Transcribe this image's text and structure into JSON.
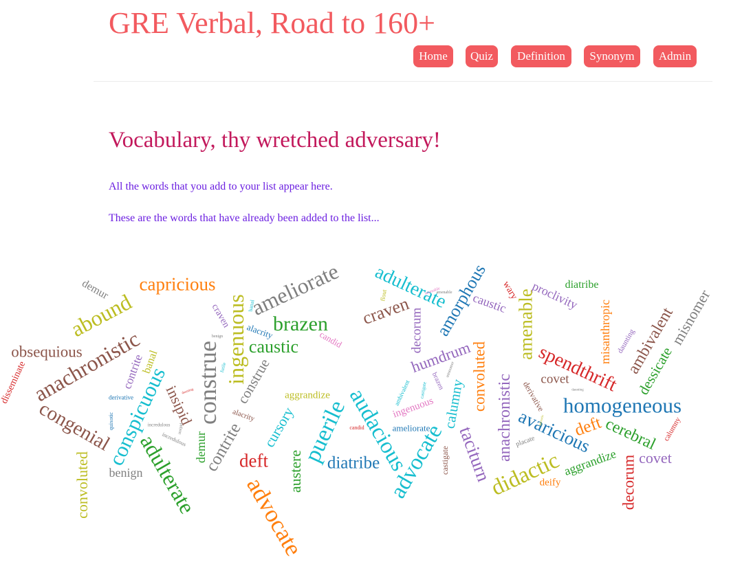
{
  "header": {
    "title": "GRE Verbal, Road to 160+",
    "nav": [
      "Home",
      "Quiz",
      "Definition",
      "Synonym",
      "Admin"
    ],
    "accent_color": "#f25a5f"
  },
  "main": {
    "heading": "Vocabulary, thy wretched adversary!",
    "para1": "All the words that you add to your list appear here.",
    "para2": "These are the words that have already been added to the list..."
  },
  "word_cloud": {
    "words": [
      {
        "text": "demur",
        "color": "#7f7f7f",
        "rotation": 30,
        "weight": 16
      },
      {
        "text": "capricious",
        "color": "#ff7f0e",
        "rotation": 0,
        "weight": 27
      },
      {
        "text": "abound",
        "color": "#bcbd22",
        "rotation": -28,
        "weight": 32
      },
      {
        "text": "obsequious",
        "color": "#8c564b",
        "rotation": 0,
        "weight": 23
      },
      {
        "text": "anachronistic",
        "color": "#8c564b",
        "rotation": -30,
        "weight": 32
      },
      {
        "text": "disseminate",
        "color": "#d62728",
        "rotation": -65,
        "weight": 14
      },
      {
        "text": "congenial",
        "color": "#8c564b",
        "rotation": 30,
        "weight": 29
      },
      {
        "text": "contrite",
        "color": "#9467bd",
        "rotation": -70,
        "weight": 17
      },
      {
        "text": "banal",
        "color": "#bcbd22",
        "rotation": -70,
        "weight": 16
      },
      {
        "text": "conspicuous",
        "color": "#17becf",
        "rotation": -65,
        "weight": 31
      },
      {
        "text": "insipid",
        "color": "#8c564b",
        "rotation": 65,
        "weight": 22
      },
      {
        "text": "adulterate",
        "color": "#2ca02c",
        "rotation": 60,
        "weight": 32
      },
      {
        "text": "convoluted",
        "color": "#bcbd22",
        "rotation": -90,
        "weight": 22
      },
      {
        "text": "benign",
        "color": "#7f7f7f",
        "rotation": 0,
        "weight": 18
      },
      {
        "text": "derivative",
        "color": "#1f77b4",
        "rotation": 0,
        "weight": 9
      },
      {
        "text": "quixotic",
        "color": "#1f77b4",
        "rotation": -90,
        "weight": 8
      },
      {
        "text": "incredulous",
        "color": "#7f7f7f",
        "rotation": 0,
        "weight": 7
      },
      {
        "text": "incredulous",
        "color": "#7f7f7f",
        "rotation": 25,
        "weight": 8
      },
      {
        "text": "craven",
        "color": "#9467bd",
        "rotation": 60,
        "weight": 14
      },
      {
        "text": "banal",
        "color": "#17becf",
        "rotation": -80,
        "weight": 8
      },
      {
        "text": "benign",
        "color": "#7f7f7f",
        "rotation": 0,
        "weight": 6
      },
      {
        "text": "ingenuous",
        "color": "#bcbd22",
        "rotation": -90,
        "weight": 32
      },
      {
        "text": "ameliorate",
        "color": "#7f7f7f",
        "rotation": -25,
        "weight": 32
      },
      {
        "text": "brazen",
        "color": "#2ca02c",
        "rotation": 0,
        "weight": 30
      },
      {
        "text": "alacrity",
        "color": "#1f77b4",
        "rotation": 20,
        "weight": 13
      },
      {
        "text": "caustic",
        "color": "#2ca02c",
        "rotation": 0,
        "weight": 26
      },
      {
        "text": "candid",
        "color": "#e377c2",
        "rotation": 30,
        "weight": 13
      },
      {
        "text": "construe",
        "color": "#7f7f7f",
        "rotation": -90,
        "weight": 36
      },
      {
        "text": "construe",
        "color": "#7f7f7f",
        "rotation": -60,
        "weight": 21
      },
      {
        "text": "futile",
        "color": "#17becf",
        "rotation": -75,
        "weight": 7
      },
      {
        "text": "demur",
        "color": "#2ca02c",
        "rotation": -90,
        "weight": 18
      },
      {
        "text": "contrite",
        "color": "#7f7f7f",
        "rotation": -60,
        "weight": 25
      },
      {
        "text": "alacrity",
        "color": "#8c564b",
        "rotation": 20,
        "weight": 11
      },
      {
        "text": "cursory",
        "color": "#17becf",
        "rotation": -60,
        "weight": 21
      },
      {
        "text": "aggrandize",
        "color": "#bcbd22",
        "rotation": 0,
        "weight": 15
      },
      {
        "text": "deft",
        "color": "#d62728",
        "rotation": 0,
        "weight": 27
      },
      {
        "text": "austere",
        "color": "#2ca02c",
        "rotation": -90,
        "weight": 22
      },
      {
        "text": "advocate",
        "color": "#ff7f0e",
        "rotation": 60,
        "weight": 35
      },
      {
        "text": "puerile",
        "color": "#17becf",
        "rotation": -65,
        "weight": 34
      },
      {
        "text": "diatribe",
        "color": "#1f77b4",
        "rotation": 0,
        "weight": 25
      },
      {
        "text": "audacious",
        "color": "#17becf",
        "rotation": 60,
        "weight": 33
      },
      {
        "text": "adulterate",
        "color": "#17becf",
        "rotation": 25,
        "weight": 28
      },
      {
        "text": "flout",
        "color": "#bcbd22",
        "rotation": -80,
        "weight": 9
      },
      {
        "text": "craven",
        "color": "#8c564b",
        "rotation": -20,
        "weight": 26
      },
      {
        "text": "decorum",
        "color": "#9467bd",
        "rotation": -90,
        "weight": 19
      },
      {
        "text": "amenable",
        "color": "#7f7f7f",
        "rotation": 0,
        "weight": 6
      },
      {
        "text": "amorphous",
        "color": "#1f77b4",
        "rotation": -60,
        "weight": 26
      },
      {
        "text": "caustic",
        "color": "#9467bd",
        "rotation": 20,
        "weight": 18
      },
      {
        "text": "wary",
        "color": "#d62728",
        "rotation": 60,
        "weight": 14
      },
      {
        "text": "proclivity",
        "color": "#9467bd",
        "rotation": 25,
        "weight": 18
      },
      {
        "text": "diatribe",
        "color": "#2ca02c",
        "rotation": 0,
        "weight": 16
      },
      {
        "text": "amenable",
        "color": "#bcbd22",
        "rotation": -90,
        "weight": 27
      },
      {
        "text": "misanthropic",
        "color": "#ff7f0e",
        "rotation": -90,
        "weight": 18
      },
      {
        "text": "ambivalent",
        "color": "#8c564b",
        "rotation": -60,
        "weight": 24
      },
      {
        "text": "misnomer",
        "color": "#7f7f7f",
        "rotation": -60,
        "weight": 22
      },
      {
        "text": "daunting",
        "color": "#9467bd",
        "rotation": -60,
        "weight": 11
      },
      {
        "text": "dessicate",
        "color": "#2ca02c",
        "rotation": -60,
        "weight": 21
      },
      {
        "text": "humdrum",
        "color": "#9467bd",
        "rotation": -20,
        "weight": 23
      },
      {
        "text": "convoluted",
        "color": "#ff7f0e",
        "rotation": -90,
        "weight": 23
      },
      {
        "text": "spendthrift",
        "color": "#d62728",
        "rotation": 25,
        "weight": 28
      },
      {
        "text": "covet",
        "color": "#8c564b",
        "rotation": 0,
        "weight": 19
      },
      {
        "text": "derivative",
        "color": "#8c564b",
        "rotation": 60,
        "weight": 12
      },
      {
        "text": "homogeneous",
        "color": "#1f77b4",
        "rotation": 0,
        "weight": 31
      },
      {
        "text": "avaricious",
        "color": "#1f77b4",
        "rotation": 25,
        "weight": 27
      },
      {
        "text": "deft",
        "color": "#ff7f0e",
        "rotation": -20,
        "weight": 25
      },
      {
        "text": "cerebral",
        "color": "#2ca02c",
        "rotation": 25,
        "weight": 24
      },
      {
        "text": "calumny",
        "color": "#d62728",
        "rotation": -60,
        "weight": 11
      },
      {
        "text": "covet",
        "color": "#9467bd",
        "rotation": 0,
        "weight": 22
      },
      {
        "text": "decorum",
        "color": "#d62728",
        "rotation": -90,
        "weight": 23
      },
      {
        "text": "aggrandize",
        "color": "#2ca02c",
        "rotation": -20,
        "weight": 18
      },
      {
        "text": "deify",
        "color": "#ff7f0e",
        "rotation": 0,
        "weight": 15
      },
      {
        "text": "didactic",
        "color": "#bcbd22",
        "rotation": -25,
        "weight": 33
      },
      {
        "text": "anachronistic",
        "color": "#9467bd",
        "rotation": -90,
        "weight": 24
      },
      {
        "text": "placate",
        "color": "#7f7f7f",
        "rotation": -20,
        "weight": 10
      },
      {
        "text": "taciturn",
        "color": "#9467bd",
        "rotation": 70,
        "weight": 27
      },
      {
        "text": "calumny",
        "color": "#17becf",
        "rotation": -80,
        "weight": 21
      },
      {
        "text": "advocate",
        "color": "#17becf",
        "rotation": -60,
        "weight": 33
      },
      {
        "text": "castigate",
        "color": "#8c564b",
        "rotation": -90,
        "weight": 12
      },
      {
        "text": "ameliorate",
        "color": "#1f77b4",
        "rotation": 0,
        "weight": 13
      },
      {
        "text": "ingenuous",
        "color": "#e377c2",
        "rotation": -20,
        "weight": 15
      },
      {
        "text": "ambivalent",
        "color": "#17becf",
        "rotation": -65,
        "weight": 9
      },
      {
        "text": "brazen",
        "color": "#9467bd",
        "rotation": 65,
        "weight": 10
      },
      {
        "text": "castigate",
        "color": "#17becf",
        "rotation": -80,
        "weight": 7
      },
      {
        "text": "misnomer",
        "color": "#7f7f7f",
        "rotation": -70,
        "weight": 6
      },
      {
        "text": "candid",
        "color": "#d62728",
        "rotation": 0,
        "weight": 8
      },
      {
        "text": "amenable",
        "color": "#e377c2",
        "rotation": -20,
        "weight": 6
      },
      {
        "text": "daunting",
        "color": "#7f7f7f",
        "rotation": 0,
        "weight": 5
      },
      {
        "text": "quixotic",
        "color": "#bcbd22",
        "rotation": -75,
        "weight": 5
      },
      {
        "text": "insipid",
        "color": "#7f7f7f",
        "rotation": -80,
        "weight": 6
      },
      {
        "text": "daunting",
        "color": "#d62728",
        "rotation": -20,
        "weight": 5
      }
    ]
  }
}
